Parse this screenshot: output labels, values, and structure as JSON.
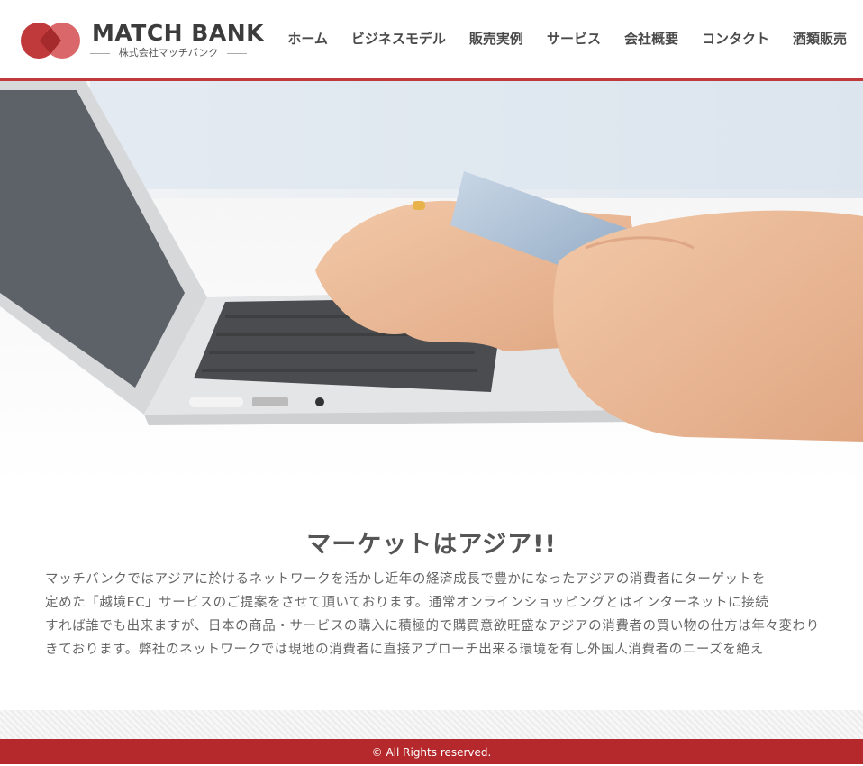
{
  "brand": {
    "name": "MATCH BANK",
    "subtitle": "株式会社マッチバンク",
    "colors": {
      "accent": "#c0393b",
      "footer": "#b5282b"
    }
  },
  "nav": {
    "items": [
      {
        "label": "ホーム"
      },
      {
        "label": "ビジネスモデル"
      },
      {
        "label": "販売実例"
      },
      {
        "label": "サービス"
      },
      {
        "label": "会社概要"
      },
      {
        "label": "コンタクト"
      },
      {
        "label": "酒類販売"
      }
    ]
  },
  "hero": {
    "image": "laptop-credit-card-shopping-photo"
  },
  "section": {
    "title": "マーケットはアジア!!",
    "lines": [
      "マッチバンクではアジアに於けるネットワークを活かし近年の経済成長で豊かになったアジアの消費者にターゲットを",
      "定めた「越境EC」サービスのご提案をさせて頂いております。通常オンラインショッピングとはインターネットに接続",
      "すれば誰でも出来ますが、日本の商品・サービスの購入に積極的で購買意欲旺盛なアジアの消費者の買い物の仕方は年々変わりつつ",
      "きております。弊社のネットワークでは現地の消費者に直接アプローチ出来る環境を有し外国人消費者のニーズを絶え"
    ]
  },
  "footer": {
    "copyright": "© All Rights reserved."
  }
}
